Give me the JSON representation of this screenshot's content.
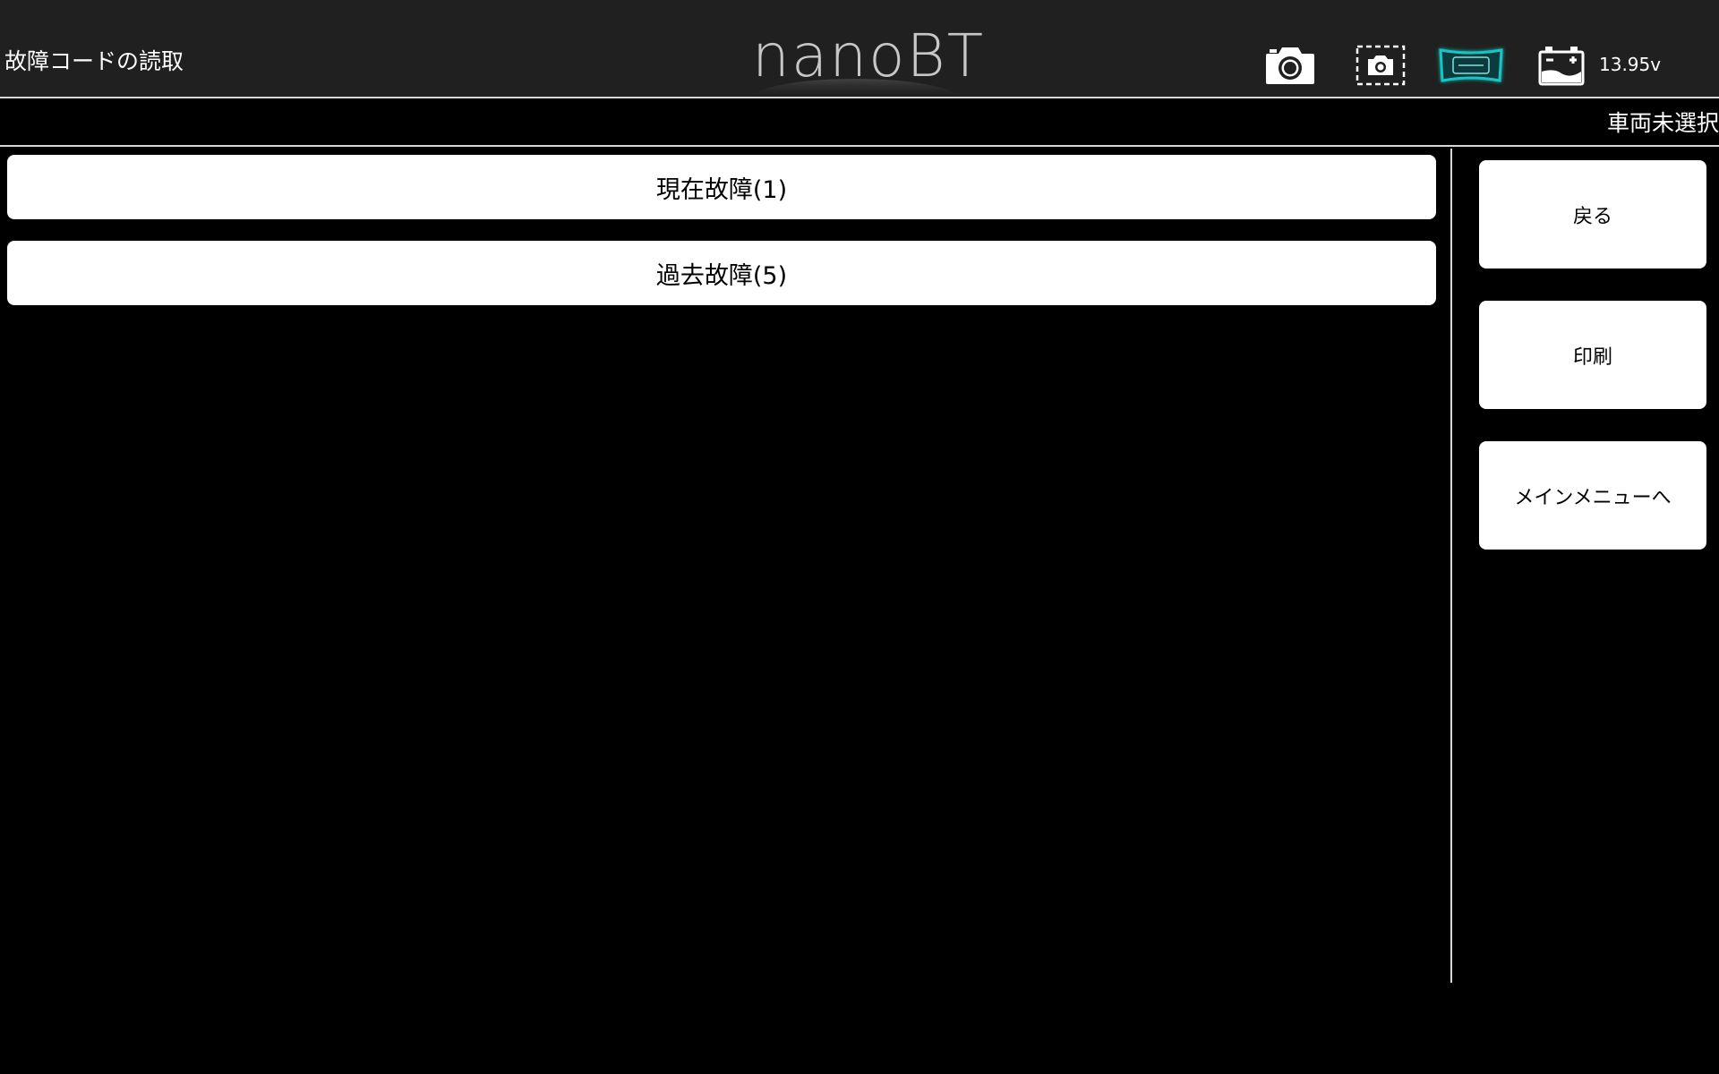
{
  "header": {
    "title": "故障コードの読取",
    "logo_text": "nanoBT",
    "voltage": "13.95v",
    "icons": [
      "camera-icon",
      "screenshot-icon",
      "vci-connection-icon",
      "battery-icon"
    ],
    "accent_color": "#19c6c6"
  },
  "status_bar": {
    "vehicle": "車両未選択"
  },
  "list": {
    "items": [
      {
        "label": "現在故障(1)"
      },
      {
        "label": "過去故障(5)"
      }
    ]
  },
  "side_menu": {
    "back": "戻る",
    "print": "印刷",
    "main_menu": "メインメニューへ"
  }
}
